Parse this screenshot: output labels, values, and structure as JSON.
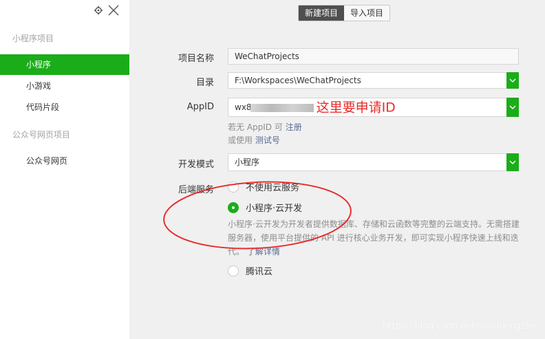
{
  "sidebar": {
    "sections": [
      {
        "title": "小程序项目",
        "items": [
          "小程序",
          "小游戏",
          "代码片段"
        ]
      },
      {
        "title": "公众号网页项目",
        "items": [
          "公众号网页"
        ]
      }
    ],
    "active_item": "小程序"
  },
  "tabs": {
    "new_project": "新建项目",
    "import_project": "导入项目",
    "active": "新建项目"
  },
  "form": {
    "project_name_label": "项目名称",
    "project_name_value": "WeChatProjects",
    "directory_label": "目录",
    "directory_value": "F:\\Workspaces\\WeChatProjects",
    "appid_label": "AppID",
    "appid_prefix": "wx8",
    "appid_overlay_note": "这里要申请ID",
    "appid_hint_line1_prefix": "若无 AppID 可",
    "appid_hint_line1_link": "注册",
    "appid_hint_line2_prefix": "或使用",
    "appid_hint_line2_link": "测试号",
    "dev_mode_label": "开发模式",
    "dev_mode_value": "小程序",
    "backend_label": "后端服务",
    "backend_options": [
      "不使用云服务",
      "小程序·云开发",
      "腾讯云"
    ],
    "backend_selected": "小程序·云开发",
    "cloud_desc": "小程序·云开发为开发者提供数据库、存储和云函数等完整的云端支持。无需搭建服务器，使用平台提供的 API 进行核心业务开发，即可实现小程序快速上线和迭代。",
    "cloud_desc_link": "了解详情"
  },
  "watermark": "https://blog.csdn.net/wanlixingzhe",
  "colors": {
    "brand_green": "#1aad19",
    "annotation_red": "#e82c2c",
    "link_blue": "#576b95"
  }
}
